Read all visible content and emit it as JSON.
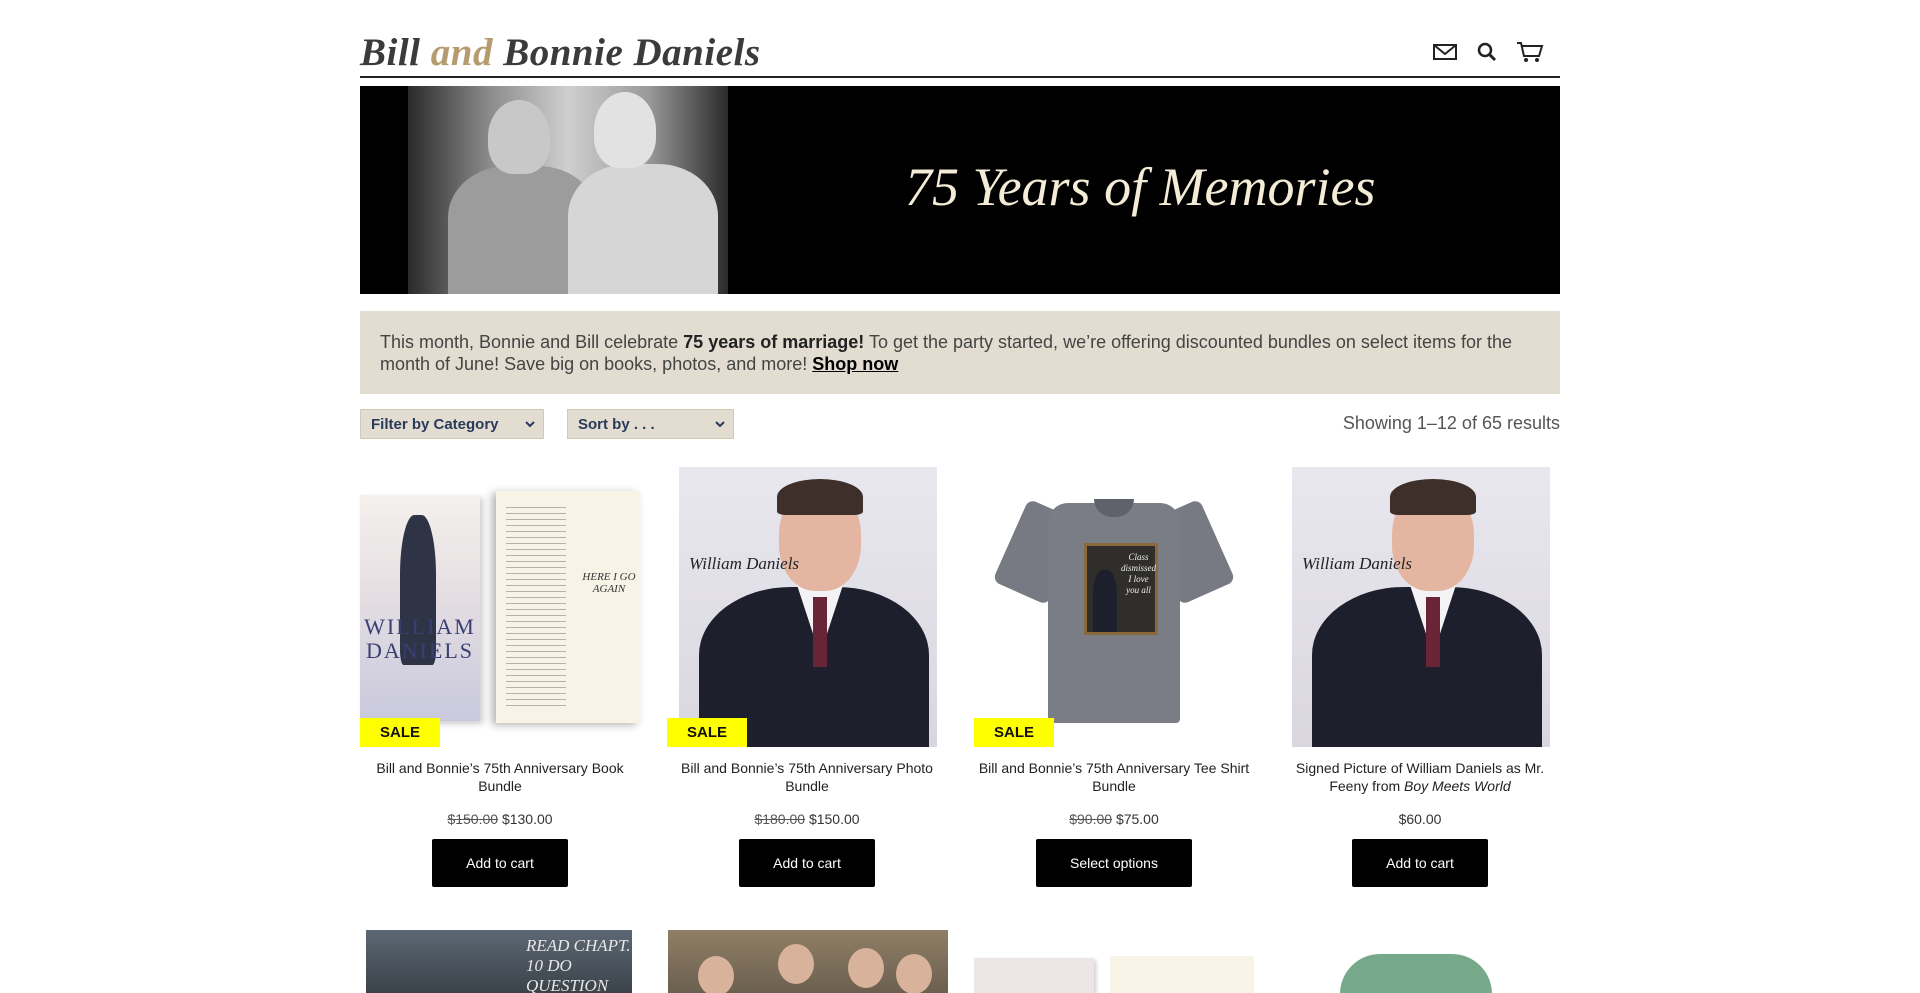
{
  "header": {
    "logo_part1": "Bill ",
    "logo_and": "and",
    "logo_part2": " Bonnie Daniels",
    "icons": [
      "mail-icon",
      "search-icon",
      "cart-icon"
    ]
  },
  "banner": {
    "title": "75 Years of Memories"
  },
  "notice": {
    "text_before": "This month, Bonnie and Bill celebrate ",
    "bold": "75 years of marriage!",
    "text_after": " To get the party started, we’re offering discounted bundles on select items for the month of June! Save big on books, photos, and more! ",
    "link": "Shop now"
  },
  "controls": {
    "category_select": "Filter by Category",
    "sort_select": "Sort by . . .",
    "results_text": "Showing 1–12 of 65 results"
  },
  "products": [
    {
      "name": "Bill and Bonnie’s 75th Anniversary Book Bundle",
      "old_price": "$150.00",
      "price": "$130.00",
      "button": "Add to cart",
      "sale": "SALE"
    },
    {
      "name": "Bill and Bonnie’s 75th Anniversary Photo Bundle",
      "old_price": "$180.00",
      "price": "$150.00",
      "button": "Add to cart",
      "sale": "SALE"
    },
    {
      "name": "Bill and Bonnie’s 75th Anniversary Tee Shirt Bundle",
      "old_price": "$90.00",
      "price": "$75.00",
      "button": "Select options",
      "sale": "SALE"
    },
    {
      "name_prefix": "Signed Picture of William Daniels as Mr. Feeny from ",
      "name_italic": "Boy Meets World",
      "price": "$60.00",
      "button": "Add to cart"
    }
  ],
  "images": {
    "book_cover_text": "WILLIAM DANIELS",
    "book_page_sig": "HERE I GO AGAIN",
    "portrait_sig": "William Daniels",
    "tee_chalk": "Class dismissed I love you all",
    "row2_chalk": "READ CHAPT. 10 DO QUESTION"
  },
  "colors": {
    "accent_gold": "#b59b6e",
    "notice_bg": "#e2ddd0",
    "sale_badge": "#ffff00",
    "button_bg": "#000000"
  }
}
